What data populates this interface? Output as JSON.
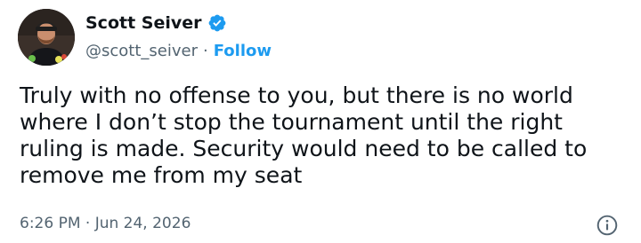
{
  "author": {
    "display_name": "Scott Seiver",
    "handle": "@scott_seiver",
    "separator": "·",
    "follow_label": "Follow",
    "verified_icon": "verified-badge-icon",
    "avatar_icon": "profile-photo"
  },
  "tweet": {
    "text": "Truly with no offense to you, but there is no world where I don’t stop the tournament until the right ruling is made. Security would need to be called to remove me from my seat",
    "timestamp": "6:26 PM · Jun 24, 2026"
  },
  "actions": {
    "info_icon": "info-icon"
  },
  "colors": {
    "text": "#0f1419",
    "secondary": "#536471",
    "accent": "#1d9bf0"
  }
}
